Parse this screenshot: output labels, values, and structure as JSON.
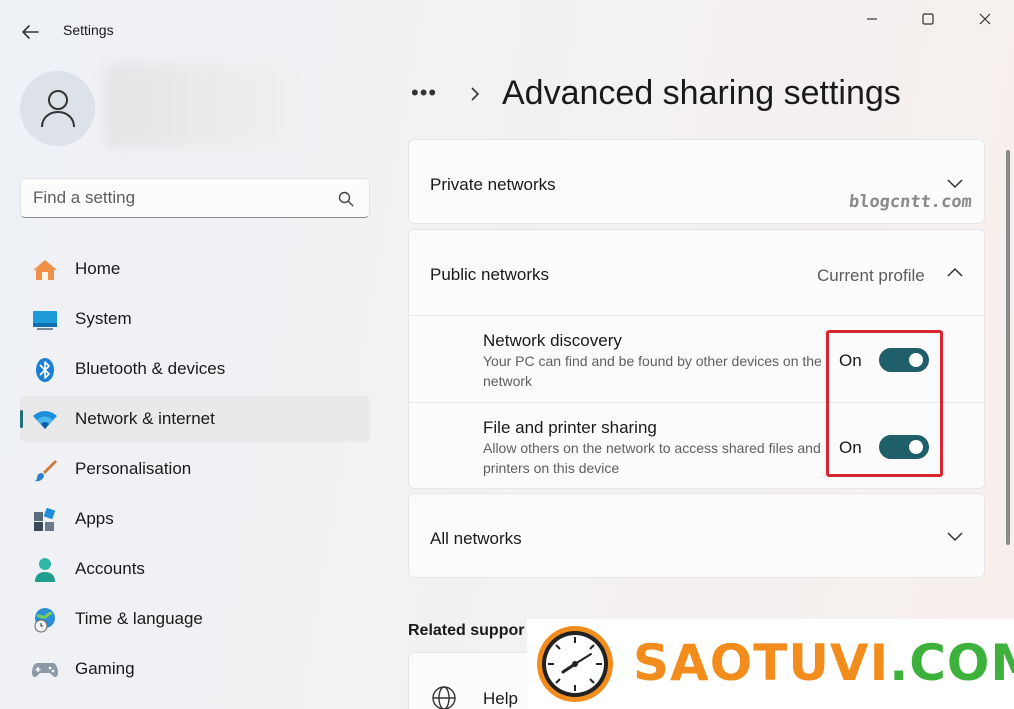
{
  "window": {
    "title": "Settings"
  },
  "user": {
    "name_blurred": true
  },
  "search": {
    "placeholder": "Find a setting"
  },
  "sidebar": {
    "items": [
      {
        "label": "Home",
        "icon": "home-icon",
        "active": false
      },
      {
        "label": "System",
        "icon": "system-icon",
        "active": false
      },
      {
        "label": "Bluetooth & devices",
        "icon": "bluetooth-icon",
        "active": false
      },
      {
        "label": "Network & internet",
        "icon": "wifi-icon",
        "active": true
      },
      {
        "label": "Personalisation",
        "icon": "brush-icon",
        "active": false
      },
      {
        "label": "Apps",
        "icon": "apps-icon",
        "active": false
      },
      {
        "label": "Accounts",
        "icon": "accounts-icon",
        "active": false
      },
      {
        "label": "Time & language",
        "icon": "globe-clock-icon",
        "active": false
      },
      {
        "label": "Gaming",
        "icon": "gamepad-icon",
        "active": false
      }
    ]
  },
  "header": {
    "breadcrumb_more": "•••",
    "title": "Advanced sharing settings"
  },
  "sections": {
    "private": {
      "label": "Private networks",
      "expanded": false
    },
    "public": {
      "label": "Public networks",
      "badge": "Current profile",
      "expanded": true,
      "settings": [
        {
          "title": "Network discovery",
          "description": "Your PC can find and be found by other devices on the network",
          "state_label": "On",
          "on": true
        },
        {
          "title": "File and printer sharing",
          "description": "Allow others on the network to access shared files and printers on this device",
          "state_label": "On",
          "on": true
        }
      ]
    },
    "all": {
      "label": "All networks",
      "expanded": false
    }
  },
  "related": {
    "title": "Related suppor",
    "help_label": "Help "
  },
  "watermarks": {
    "blog": "blogcntt.com",
    "logo_main": "SAOTUVI",
    "logo_suffix": ".COM"
  },
  "colors": {
    "accent": "#1f5f6a",
    "highlight": "#d9262e",
    "logo_orange": "#f28c1c",
    "logo_green": "#3db13c"
  }
}
